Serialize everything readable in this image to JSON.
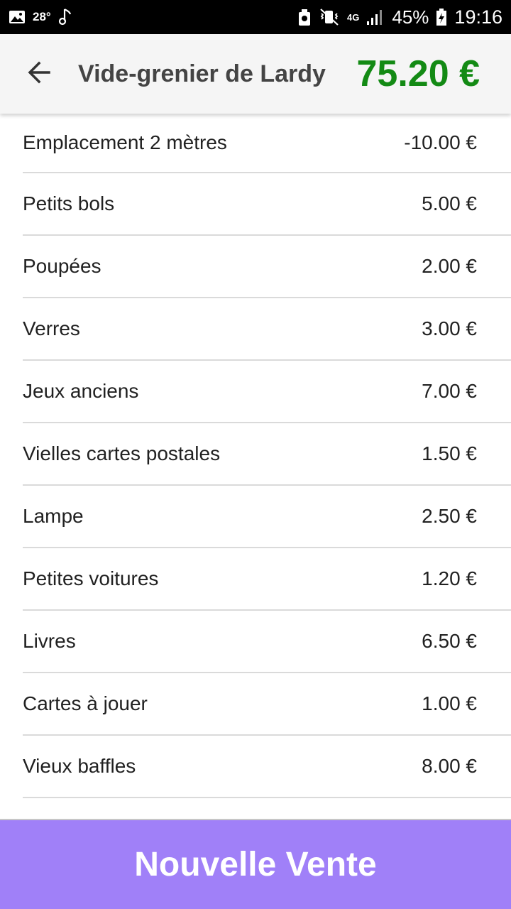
{
  "status_bar": {
    "temperature": "28°",
    "network": "4G",
    "battery": "45%",
    "time": "19:16",
    "icons": [
      "image-icon",
      "music-note-icon",
      "recycle-icon",
      "vibrate-mute-icon",
      "signal-icon",
      "battery-icon"
    ]
  },
  "app_bar": {
    "back_icon": "arrow-left-icon",
    "title": "Vide-grenier de Lardy",
    "total": "75.20 €",
    "total_color": "#138a14",
    "background": "#f5f5f5"
  },
  "items": [
    {
      "name": "Emplacement 2 mètres",
      "price": "-10.00 €"
    },
    {
      "name": "Petits bols",
      "price": "5.00 €"
    },
    {
      "name": "Poupées",
      "price": "2.00 €"
    },
    {
      "name": "Verres",
      "price": "3.00 €"
    },
    {
      "name": "Jeux anciens",
      "price": "7.00 €"
    },
    {
      "name": "Vielles cartes postales",
      "price": "1.50 €"
    },
    {
      "name": "Lampe",
      "price": "2.50 €"
    },
    {
      "name": "Petites voitures",
      "price": "1.20 €"
    },
    {
      "name": "Livres",
      "price": "6.50 €"
    },
    {
      "name": "Cartes à jouer",
      "price": "1.00 €"
    },
    {
      "name": "Vieux baffles",
      "price": "8.00 €"
    }
  ],
  "footer": {
    "new_sale_label": "Nouvelle Vente",
    "button_color": "#a080f8"
  }
}
